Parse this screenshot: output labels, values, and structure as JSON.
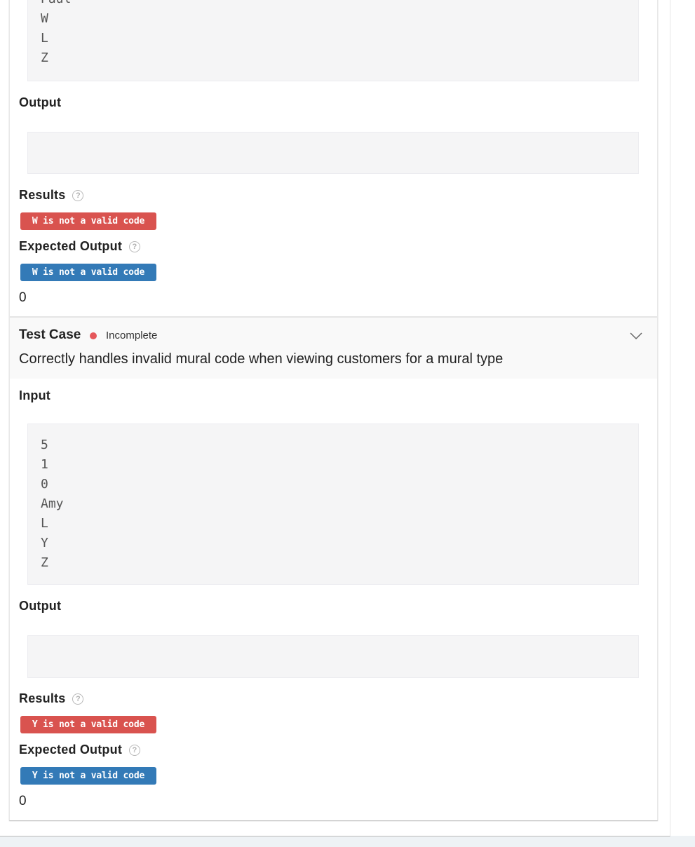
{
  "test_case_1": {
    "input_lines_visible": [
      "Paul",
      "W",
      "L",
      "Z"
    ],
    "output_label": "Output",
    "output_value": "",
    "results_label": "Results",
    "results_badge": "W is not a valid code",
    "expected_label": "Expected Output",
    "expected_badge": "W is not a valid code",
    "score": "0"
  },
  "test_case_2": {
    "title": "Test Case",
    "status": "Incomplete",
    "status_color": "#e5575b",
    "description": "Correctly handles invalid mural code when viewing customers for a mural type",
    "input_label": "Input",
    "input_lines": [
      "5",
      "1",
      "0",
      "Amy",
      "L",
      "Y",
      "Z"
    ],
    "output_label": "Output",
    "output_value": "",
    "results_label": "Results",
    "results_badge": "Y is not a valid code",
    "expected_label": "Expected Output",
    "expected_badge": "Y is not a valid code",
    "score": "0"
  },
  "colors": {
    "results_badge": "#d9534f",
    "expected_badge": "#337ab7"
  },
  "icons": {
    "help": "?",
    "chevron": "chevron-down-icon"
  }
}
